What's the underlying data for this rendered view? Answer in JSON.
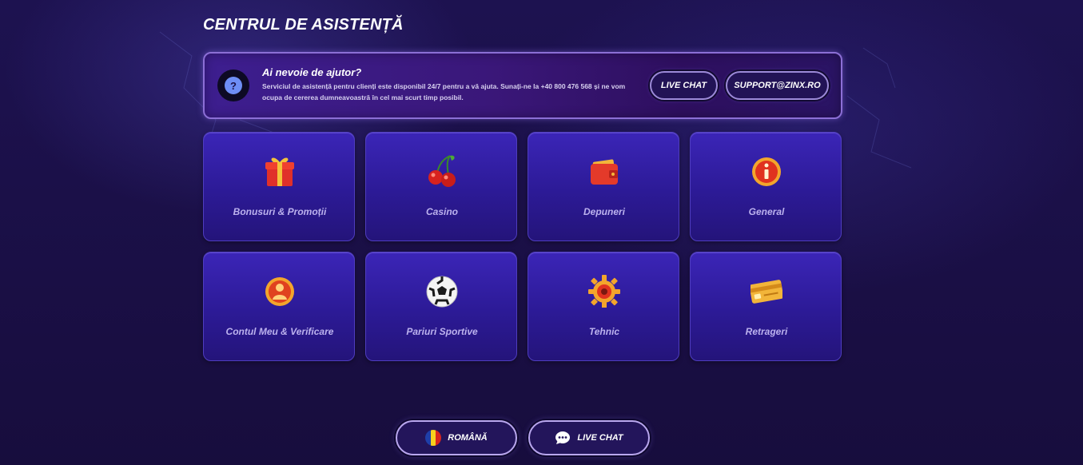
{
  "page": {
    "title": "CENTRUL DE ASISTENȚĂ"
  },
  "help_banner": {
    "icon": "question-icon",
    "heading": "Ai nevoie de ajutor?",
    "text": "Serviciul de asistență pentru clienți este disponibil 24/7 pentru a vă ajuta. Sunați-ne la +40 800 476 568 și ne vom ocupa de cererea dumneavoastră în cel mai scurt timp posibil.",
    "live_chat_label": "LIVE CHAT",
    "support_email_label": "SUPPORT@ZINX.RO"
  },
  "categories": [
    {
      "label": "Bonusuri & Promoții",
      "icon": "gift-icon"
    },
    {
      "label": "Casino",
      "icon": "cherries-icon"
    },
    {
      "label": "Depuneri",
      "icon": "wallet-icon"
    },
    {
      "label": "General",
      "icon": "info-icon"
    },
    {
      "label": "Contul Meu & Verificare",
      "icon": "user-icon"
    },
    {
      "label": "Pariuri Sportive",
      "icon": "soccer-ball-icon"
    },
    {
      "label": "Tehnic",
      "icon": "gear-icon"
    },
    {
      "label": "Retrageri",
      "icon": "card-icon"
    }
  ],
  "footer": {
    "language_label": "ROMÂNĂ",
    "language_icon": "romania-flag-icon",
    "live_chat_label": "LIVE CHAT",
    "live_chat_icon": "chat-bubble-icon"
  },
  "colors": {
    "background": "#1b1148",
    "card": "#3b25b7",
    "accent_border": "#8c6fd6",
    "help_icon": "#6e8ef6"
  }
}
